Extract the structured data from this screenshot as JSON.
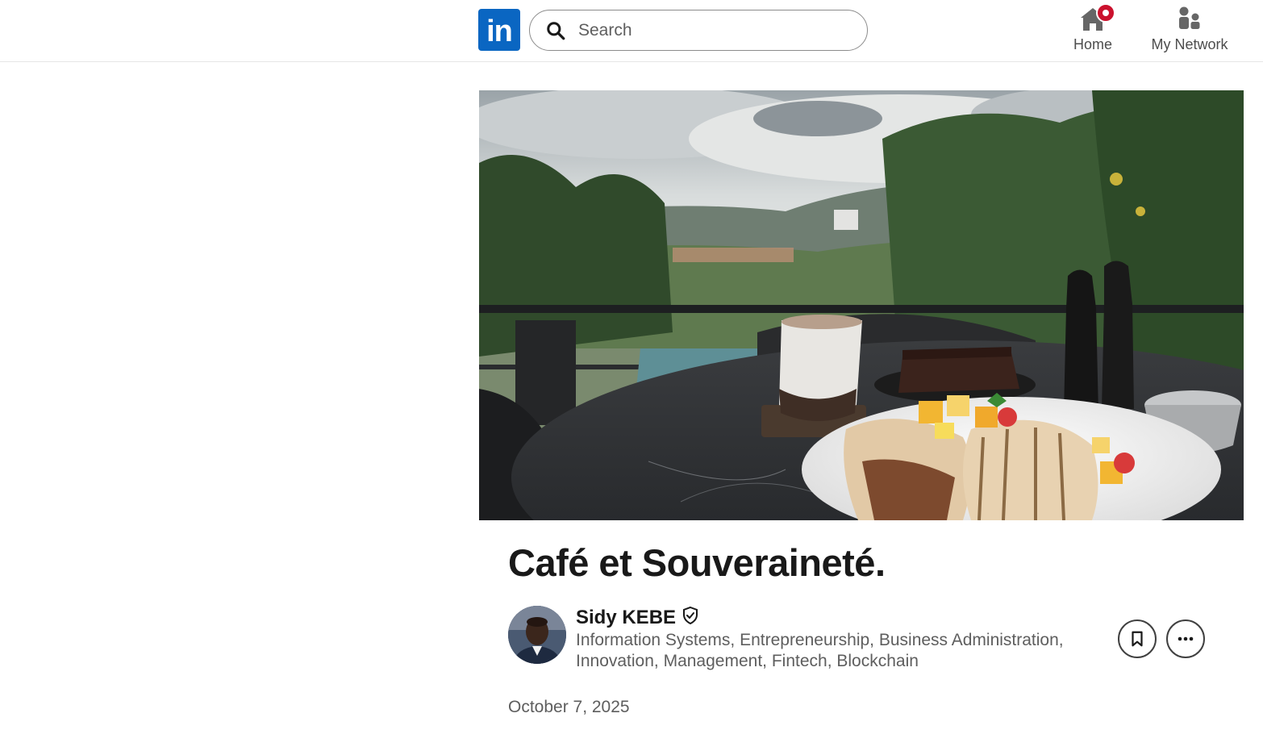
{
  "nav": {
    "logo_text": "in",
    "search_placeholder": "Search",
    "items": [
      {
        "label": "Home",
        "icon": "home-icon",
        "has_notification": true
      },
      {
        "label": "My Network",
        "icon": "network-icon"
      }
    ]
  },
  "article": {
    "title": "Café et Souveraineté.",
    "author": {
      "name": "Sidy KEBE",
      "verified": true,
      "headline": "Information Systems, Entrepreneurship, Business Administration, Innovation, Management, Fintech, Blockchain"
    },
    "date": "October 7, 2025",
    "actions": [
      "bookmark-icon",
      "more-options-icon"
    ]
  },
  "colors": {
    "brand": "#0a66c2",
    "notification": "#cb112d",
    "text_primary": "#191919",
    "text_secondary": "#5e5e5e"
  }
}
